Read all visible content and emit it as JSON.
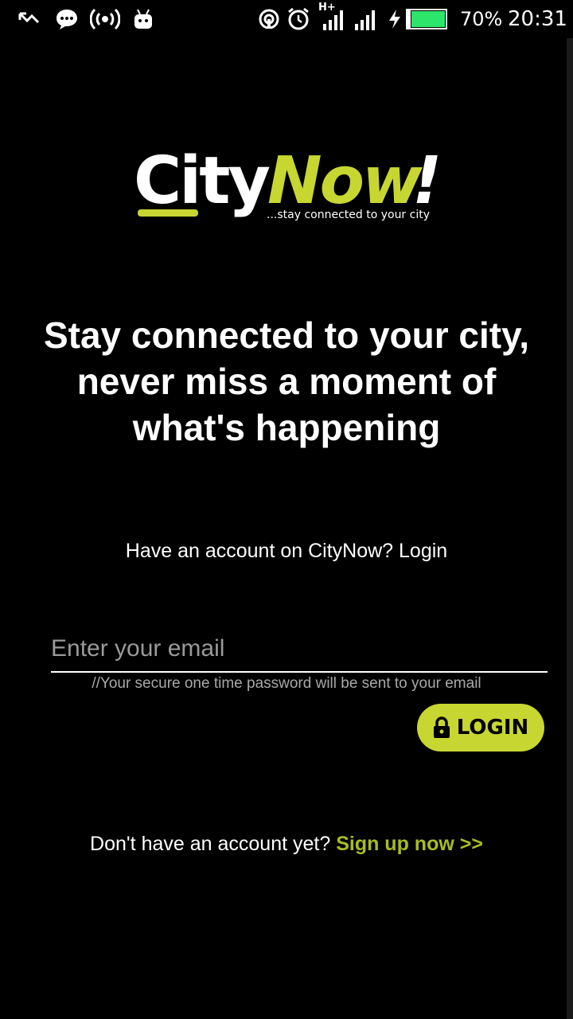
{
  "status_bar": {
    "battery_percent": "70%",
    "time": "20:31",
    "network_type": "H+",
    "icons": [
      "missed-call-icon",
      "message-icon",
      "hotspot-icon",
      "android-icon",
      "nfc-icon",
      "alarm-icon",
      "signal-icon",
      "signal-icon",
      "charging-icon",
      "battery-icon"
    ],
    "battery_level": 0.7,
    "battery_color": "#2ee56b"
  },
  "logo": {
    "city": "City",
    "now": "Now",
    "bang": "!",
    "tagline": "...stay connected to your city",
    "accent_color": "#c8d631"
  },
  "headline": "Stay connected to your city, never miss a moment of what's happening",
  "login_prompt": "Have an account on CityNow? Login",
  "email": {
    "placeholder": "Enter your email",
    "value": "",
    "hint": "//Your secure one time password will be sent to your email"
  },
  "login_button": {
    "label": "LOGIN",
    "icon": "lock-icon",
    "color": "#c8d631"
  },
  "signup": {
    "prompt": "Don't have an account yet?",
    "link": "Sign up now >>",
    "link_color": "#a9bb22"
  }
}
